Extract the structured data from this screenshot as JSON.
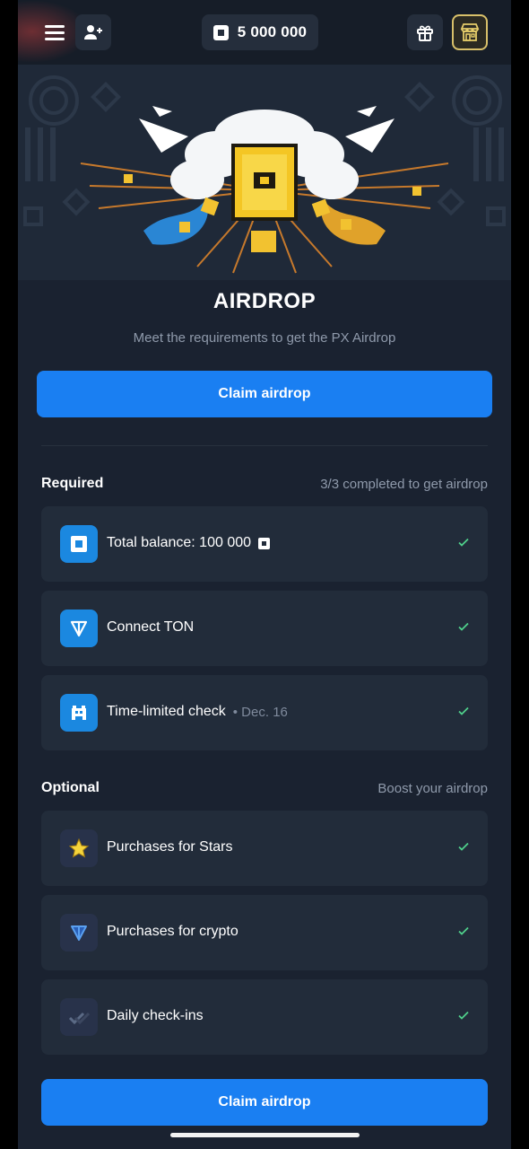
{
  "header": {
    "balance": "5 000 000",
    "icons": {
      "menu": "menu-icon",
      "add_user": "add-user-icon",
      "gift": "gift-icon",
      "shop": "shop-icon",
      "currency": "px-coin-icon"
    }
  },
  "hero": {
    "title": "AIRDROP",
    "subtitle": "Meet the requirements to get the PX Airdrop"
  },
  "claim_button_label": "Claim airdrop",
  "required": {
    "title": "Required",
    "note": "3/3 completed to get airdrop",
    "items": [
      {
        "label": "Total balance: 100 000",
        "meta": "",
        "icon": "px-coin-icon",
        "completed": true
      },
      {
        "label": "Connect TON",
        "meta": "",
        "icon": "ton-icon",
        "completed": true
      },
      {
        "label": "Time-limited check",
        "meta": "• Dec. 16",
        "icon": "pixel-invader-icon",
        "completed": true
      }
    ]
  },
  "optional": {
    "title": "Optional",
    "note": "Boost your airdrop",
    "items": [
      {
        "label": "Purchases for Stars",
        "icon": "star-icon",
        "completed": true
      },
      {
        "label": "Purchases for crypto",
        "icon": "ton-icon",
        "completed": true
      },
      {
        "label": "Daily check-ins",
        "icon": "double-check-icon",
        "completed": true
      }
    ]
  },
  "colors": {
    "background": "#1a2230",
    "card": "#222c3a",
    "accent": "#1a7ff2",
    "check": "#4fd18b",
    "muted": "#8f9aab"
  }
}
